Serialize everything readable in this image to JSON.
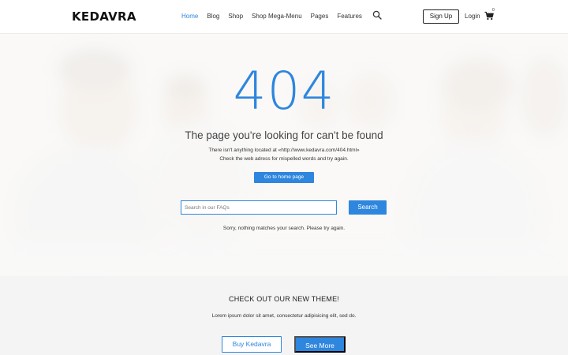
{
  "brand": {
    "logo": "KEDAVRA",
    "accent": "#2e86de"
  },
  "nav": {
    "items": [
      {
        "label": "Home",
        "active": true
      },
      {
        "label": "Blog",
        "active": false
      },
      {
        "label": "Shop",
        "active": false
      },
      {
        "label": "Shop Mega-Menu",
        "active": false
      },
      {
        "label": "Pages",
        "active": false
      },
      {
        "label": "Features",
        "active": false
      }
    ],
    "search_icon": "search-icon",
    "signup_label": "Sign Up",
    "login_label": "Login",
    "cart_icon": "cart-icon",
    "cart_count": "0"
  },
  "error": {
    "code": "404",
    "title": "The page you're looking for can't be found",
    "line1": "There isn't anything located at «http://www.kedavra.com/404.html»",
    "line2": "Check the web adress for mispelled words and try again.",
    "home_button": "Go to home page",
    "search_placeholder": "Search in our FAQs",
    "search_button": "Search",
    "no_results": "Sorry, nothing matches your search. Please try again."
  },
  "promo": {
    "title": "CHECK OUT OUR NEW THEME!",
    "text": "Lorem ipsum dolor sit amet, consectetur adipisicing elit, sed do.",
    "buy_label": "Buy Kedavra",
    "see_more_label": "See More"
  }
}
